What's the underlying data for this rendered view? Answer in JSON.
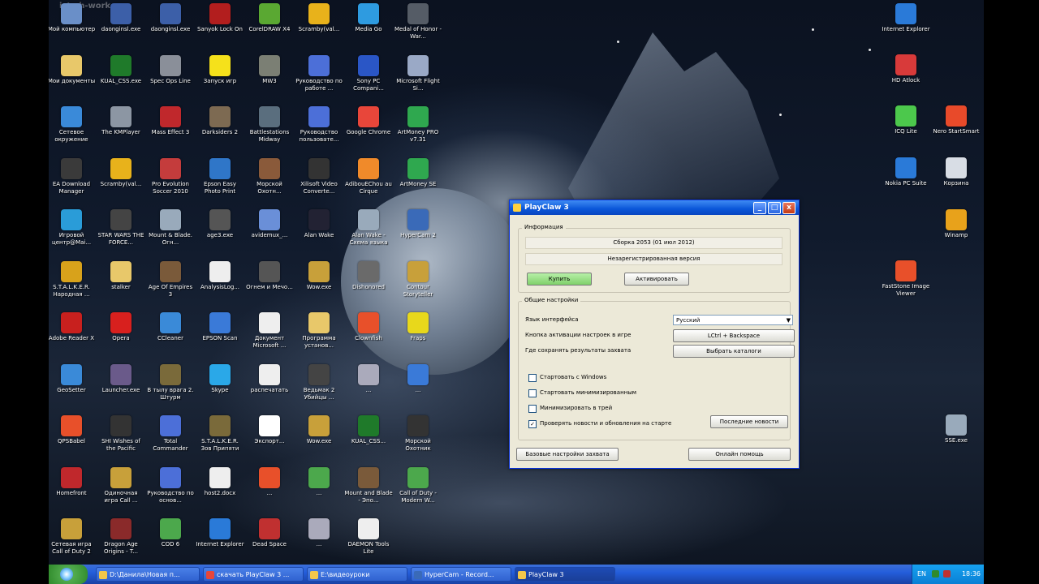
{
  "watermark": "ict-sh-work...",
  "colors": {
    "accent": "#0a56d8",
    "taskbar": "#245edb",
    "buy_button": "#7fd06a"
  },
  "icons": [
    {
      "label": "Мой компьютер",
      "color": "#6a8fc8"
    },
    {
      "label": "daonginsl.exe",
      "color": "#3c5fa8"
    },
    {
      "label": "daonginsl.exe",
      "color": "#3c5fa8"
    },
    {
      "label": "Sanyok Lock On",
      "color": "#b21e1e"
    },
    {
      "label": "CorelDRAW X4",
      "color": "#5aa832"
    },
    {
      "label": "Scramby(val...",
      "color": "#e8b21b"
    },
    {
      "label": "Media Go",
      "color": "#2e9be0"
    },
    {
      "label": "Medal of Honor - War...",
      "color": "#555c66"
    },
    {
      "label": "Мои документы",
      "color": "#e8c86a"
    },
    {
      "label": "KUAL_CSS.exe",
      "color": "#1f7a2a"
    },
    {
      "label": "Spec Ops Line",
      "color": "#8a8f99"
    },
    {
      "label": "Запуск игр",
      "color": "#f5e11b"
    },
    {
      "label": "MW3",
      "color": "#7b7f74"
    },
    {
      "label": "Руководство по работе ...",
      "color": "#4c6fd8"
    },
    {
      "label": "Sony PC Compani...",
      "color": "#2a56c6"
    },
    {
      "label": "Microsoft Flight Si...",
      "color": "#9aa9c6"
    },
    {
      "label": "Сетевое окружение",
      "color": "#3a8ad9"
    },
    {
      "label": "The KMPlayer",
      "color": "#8c96a3"
    },
    {
      "label": "Mass Effect 3",
      "color": "#c0282c"
    },
    {
      "label": "Darksiders 2",
      "color": "#7d6a52"
    },
    {
      "label": "Battlestations Midway",
      "color": "#5a6e7e"
    },
    {
      "label": "Руководство пользовате...",
      "color": "#4c6fd8"
    },
    {
      "label": "Google Chrome",
      "color": "#e8463a"
    },
    {
      "label": "ArtMoney PRO v7.31",
      "color": "#2fa84f"
    },
    {
      "label": "EA Download Manager",
      "color": "#3a3a3a"
    },
    {
      "label": "Scramby(val...",
      "color": "#e8b21b"
    },
    {
      "label": "Pro Evolution Soccer 2010",
      "color": "#c43c3c"
    },
    {
      "label": "Epson Easy Photo Print",
      "color": "#2f76c8"
    },
    {
      "label": "Морской Охотн...",
      "color": "#8a5a3a"
    },
    {
      "label": "Xilisoft Video Converte...",
      "color": "#333"
    },
    {
      "label": "AdibouEChou au Cirque",
      "color": "#f08a2a"
    },
    {
      "label": "ArtMoney SE",
      "color": "#2fa84f"
    },
    {
      "label": "Игровой центр@Mai...",
      "color": "#2a9cd8"
    },
    {
      "label": "STAR WARS THE FORCE...",
      "color": "#444"
    },
    {
      "label": "Mount & Blade. Огн...",
      "color": "#9ab"
    },
    {
      "label": "age3.exe",
      "color": "#555"
    },
    {
      "label": "avidemux_...",
      "color": "#6a8fd8"
    },
    {
      "label": "Alan Wake",
      "color": "#223"
    },
    {
      "label": "Alan Wake - Схема языка",
      "color": "#9ab"
    },
    {
      "label": "HyperCam 2",
      "color": "#3a6ab8"
    },
    {
      "label": "S.T.A.L.K.E.R. Народная ...",
      "color": "#d8a21b"
    },
    {
      "label": "stalker",
      "color": "#e8c86a"
    },
    {
      "label": "Age Of Empires 3",
      "color": "#7a5a3a"
    },
    {
      "label": "AnalysisLog...",
      "color": "#eee"
    },
    {
      "label": "Огнем и Мечо...",
      "color": "#555"
    },
    {
      "label": "Wow.exe",
      "color": "#c8a03a"
    },
    {
      "label": "Dishonored",
      "color": "#6a6a6a"
    },
    {
      "label": "Contour Storyteller",
      "color": "#c8a03a"
    },
    {
      "label": "Adobe Reader X",
      "color": "#c8201e"
    },
    {
      "label": "Opera",
      "color": "#d8201e"
    },
    {
      "label": "CCleaner",
      "color": "#3a8ad8"
    },
    {
      "label": "EPSON Scan",
      "color": "#3a7ad8"
    },
    {
      "label": "Документ Microsoft ...",
      "color": "#eee"
    },
    {
      "label": "Программа установ...",
      "color": "#e8c86a"
    },
    {
      "label": "Clownfish",
      "color": "#e8502a"
    },
    {
      "label": "Fraps",
      "color": "#e8d81b"
    },
    {
      "label": "GeoSetter",
      "color": "#3a8ad8"
    },
    {
      "label": "Launcher.exe",
      "color": "#6a5a8a"
    },
    {
      "label": "В тылу врага 2. Штурм",
      "color": "#7a6a3a"
    },
    {
      "label": "Skype",
      "color": "#2aa8e8"
    },
    {
      "label": "распечатать",
      "color": "#eee"
    },
    {
      "label": "Ведьмак 2 Убийцы ...",
      "color": "#444"
    },
    {
      "label": "...",
      "color": "#aab"
    },
    {
      "label": "...",
      "color": "#3a7ad8"
    },
    {
      "label": "QPSBabel",
      "color": "#e8502a"
    },
    {
      "label": "SHI Wishes of the Pacific",
      "color": "#333"
    },
    {
      "label": "Total Commander",
      "color": "#4c6fd8"
    },
    {
      "label": "S.T.A.L.K.E.R. Зов Припяти",
      "color": "#7a6a3a"
    },
    {
      "label": "Экспорт...",
      "color": "#fff"
    },
    {
      "label": "Wow.exe",
      "color": "#c8a03a"
    },
    {
      "label": "KUAL_CSS...",
      "color": "#1f7a2a"
    },
    {
      "label": "Морской Охотник",
      "color": "#333"
    },
    {
      "label": "Homefront",
      "color": "#c0282c"
    },
    {
      "label": "Одиночная игра Call ...",
      "color": "#c8a03a"
    },
    {
      "label": "Руководство по основ...",
      "color": "#4c6fd8"
    },
    {
      "label": "host2.docx",
      "color": "#eee"
    },
    {
      "label": "...",
      "color": "#e8502a"
    },
    {
      "label": "...",
      "color": "#4ca84c"
    },
    {
      "label": "Mount and Blade - Эпо...",
      "color": "#7a5a3a"
    },
    {
      "label": "Call of Duty - Modern W...",
      "color": "#4ca84c"
    },
    {
      "label": "Сетевая игра Call of Duty 2",
      "color": "#c8a03a"
    },
    {
      "label": "Dragon Age Origins - T...",
      "color": "#8a2a2a"
    },
    {
      "label": "COD 6",
      "color": "#4ca84c"
    },
    {
      "label": "Internet Explorer",
      "color": "#2a7ad8"
    },
    {
      "label": "Dead Space",
      "color": "#c03030"
    },
    {
      "label": "...",
      "color": "#aab"
    },
    {
      "label": "DAEMON Tools Lite",
      "color": "#eee"
    },
    {
      "label": "Internet Explorer",
      "color": "#2a7ad8"
    },
    {
      "label": "HD Atlock",
      "color": "#d83a3a"
    },
    {
      "label": "ICQ Lite",
      "color": "#4cc84c"
    },
    {
      "label": "Nero StartSmart",
      "color": "#e84a2a"
    },
    {
      "label": "Nokia PC Suite",
      "color": "#2a7ad8"
    },
    {
      "label": "Корзина",
      "color": "#d8dde5"
    },
    {
      "label": "Winamp",
      "color": "#e8a21b"
    },
    {
      "label": "FastStone Image Viewer",
      "color": "#e8502a"
    },
    {
      "label": "SSE.exe",
      "color": "#9ab"
    }
  ],
  "dialog": {
    "title": "PlayClaw 3",
    "minimize": "_",
    "maximize": "□",
    "close": "x",
    "info_group": "Информация",
    "build": "Сборка 2053 (01 июл 2012)",
    "license": "Незарегистрированная версия",
    "buy": "Купить",
    "activate": "Активировать",
    "general_group": "Общие настройки",
    "lang_label": "Язык интерфейса",
    "lang_value": "Русский",
    "hotkey_label": "Кнопка активации настроек в игре",
    "hotkey_value": "LCtrl + Backspace",
    "save_label": "Где сохранять результаты захвата",
    "save_button": "Выбрать каталоги",
    "cb_start_windows": "Стартовать с Windows",
    "cb_start_minimized": "Стартовать минимизированным",
    "cb_tray": "Минимизировать в трей",
    "cb_news": "Проверять новости и обновления на старте",
    "news_button": "Последние новости",
    "capture_settings": "Базовые настройки захвата",
    "online_help": "Онлайн помощь"
  },
  "taskbar": {
    "tasks": [
      "D:\\Данила\\Новая п...",
      "скачать PlayClaw 3 ...",
      "E:\\видеоуроки",
      "HyperCam - Record...",
      "PlayClaw 3"
    ],
    "lang": "EN",
    "time": "18:36"
  }
}
